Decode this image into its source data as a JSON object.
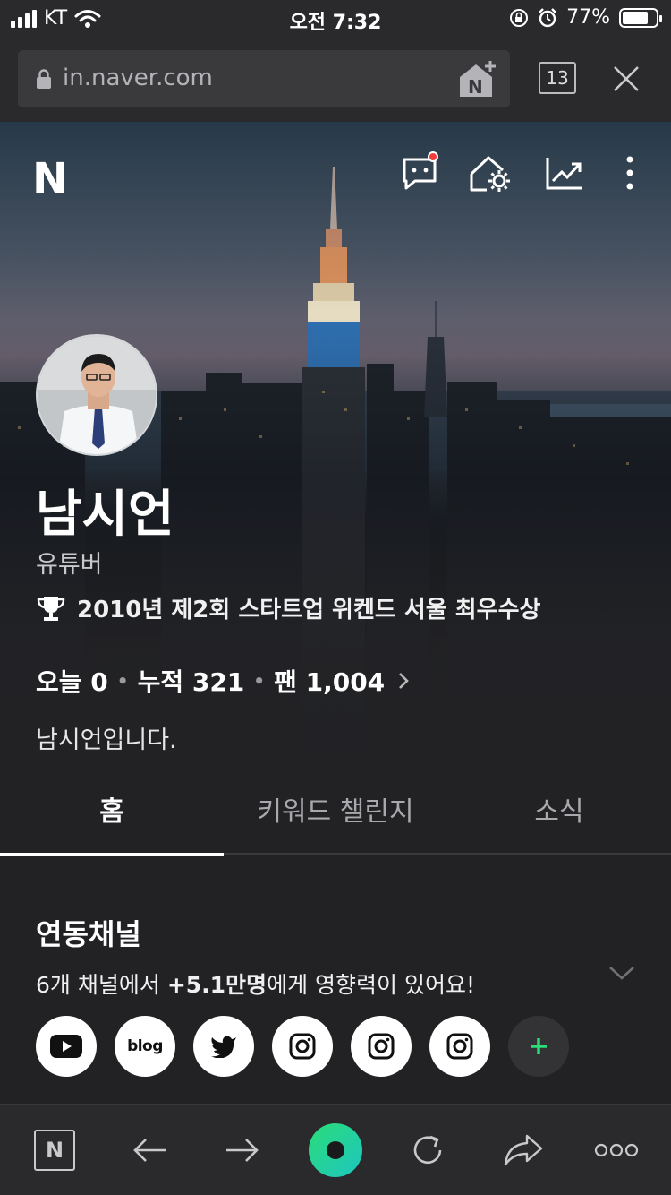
{
  "status": {
    "carrier": "KT",
    "time": "오전 7:32",
    "battery": "77%",
    "battery_level": 0.77
  },
  "browser": {
    "url": "in.naver.com",
    "tab_count": "13"
  },
  "profile": {
    "logo": "N",
    "name": "남시언",
    "role": "유튜버",
    "award": "2010년 제2회 스타트업 위켄드 서울 최우수상",
    "stats": {
      "today": "오늘 0",
      "total": "누적 321",
      "fans": "팬 1,004"
    },
    "intro": "남시언입니다."
  },
  "tabs": [
    {
      "label": "홈",
      "active": true
    },
    {
      "label": "키워드 챌린지",
      "active": false
    },
    {
      "label": "소식",
      "active": false
    }
  ],
  "channels": {
    "title": "연동채널",
    "sub_prefix": "6개 채널에서 ",
    "sub_highlight": "+5.1만명",
    "sub_suffix": "에게 영향력이 있어요!",
    "items": [
      {
        "icon": "youtube-icon"
      },
      {
        "icon": "blog-icon",
        "label": "blog"
      },
      {
        "icon": "twitter-icon"
      },
      {
        "icon": "instagram-icon"
      },
      {
        "icon": "instagram-icon"
      },
      {
        "icon": "instagram-icon"
      }
    ],
    "add_label": "+"
  },
  "toolbar": {
    "naver_label": "N"
  },
  "colors": {
    "background": "#222225",
    "accent_green": "#2bdc78",
    "notification": "#f03c3c"
  }
}
